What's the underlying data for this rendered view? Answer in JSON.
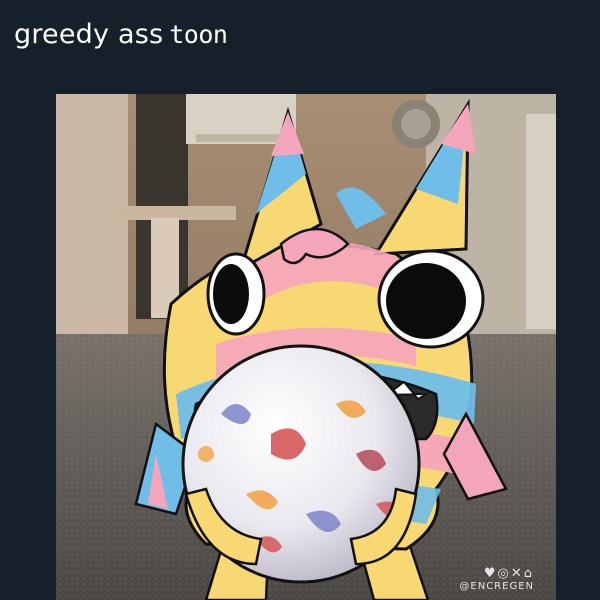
{
  "post": {
    "text_part1": "greedy ass",
    "text_part2": "toon"
  },
  "watermark": {
    "icons": "♥◎✕⌂",
    "handle": "@ENCREGEN"
  },
  "colors": {
    "background": "#15202b",
    "text": "#ffffff",
    "toon_yellow": "#f7d873",
    "toon_blue": "#6fbde8",
    "toon_pink": "#f4a5bc",
    "ball_white": "#ecebf0"
  }
}
